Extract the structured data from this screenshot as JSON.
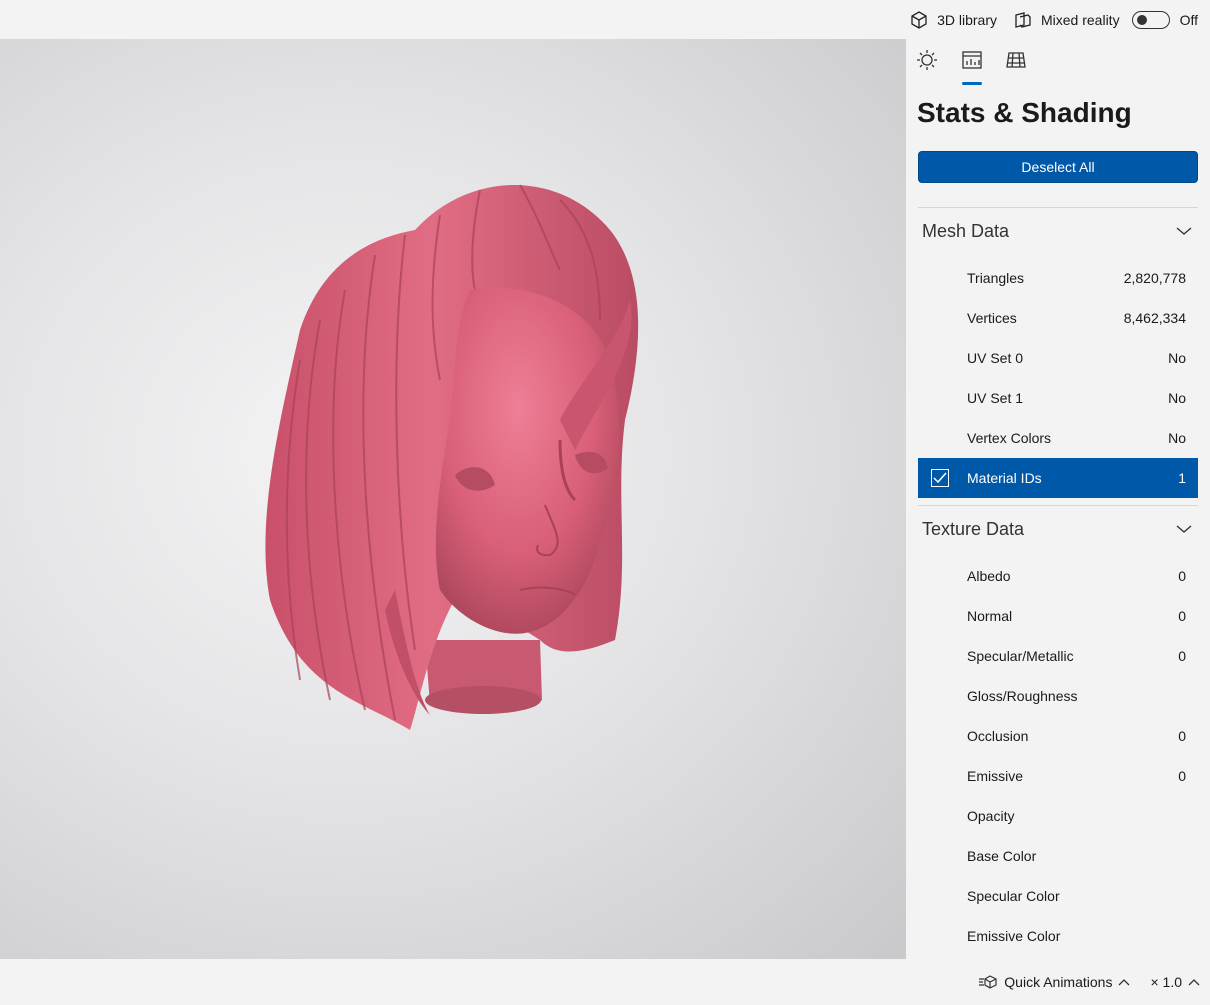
{
  "topbar": {
    "library_label": "3D library",
    "mixed_reality_label": "Mixed reality",
    "toggle_state": "Off"
  },
  "panel": {
    "tabs": [
      {
        "icon": "lighting-icon"
      },
      {
        "icon": "stats-icon",
        "active": true
      },
      {
        "icon": "grid-icon"
      }
    ],
    "title": "Stats & Shading",
    "deselect_label": "Deselect All",
    "mesh_section": {
      "title": "Mesh Data",
      "rows": [
        {
          "label": "Triangles",
          "value": "2,820,778"
        },
        {
          "label": "Vertices",
          "value": "8,462,334"
        },
        {
          "label": "UV Set 0",
          "value": "No"
        },
        {
          "label": "UV Set 1",
          "value": "No"
        },
        {
          "label": "Vertex Colors",
          "value": "No"
        },
        {
          "label": "Material IDs",
          "value": "1",
          "selected": true
        }
      ]
    },
    "texture_section": {
      "title": "Texture Data",
      "rows": [
        {
          "label": "Albedo",
          "value": "0"
        },
        {
          "label": "Normal",
          "value": "0"
        },
        {
          "label": "Specular/Metallic",
          "value": "0"
        },
        {
          "label": "Gloss/Roughness",
          "value": ""
        },
        {
          "label": "Occlusion",
          "value": "0"
        },
        {
          "label": "Emissive",
          "value": "0"
        },
        {
          "label": "Opacity",
          "value": ""
        },
        {
          "label": "Base Color",
          "value": ""
        },
        {
          "label": "Specular Color",
          "value": ""
        },
        {
          "label": "Emissive Color",
          "value": ""
        }
      ]
    }
  },
  "bottombar": {
    "animations_label": "Quick Animations",
    "speed_label": "× 1.0"
  },
  "colors": {
    "accent": "#0058a8",
    "model": "#e06a82"
  }
}
